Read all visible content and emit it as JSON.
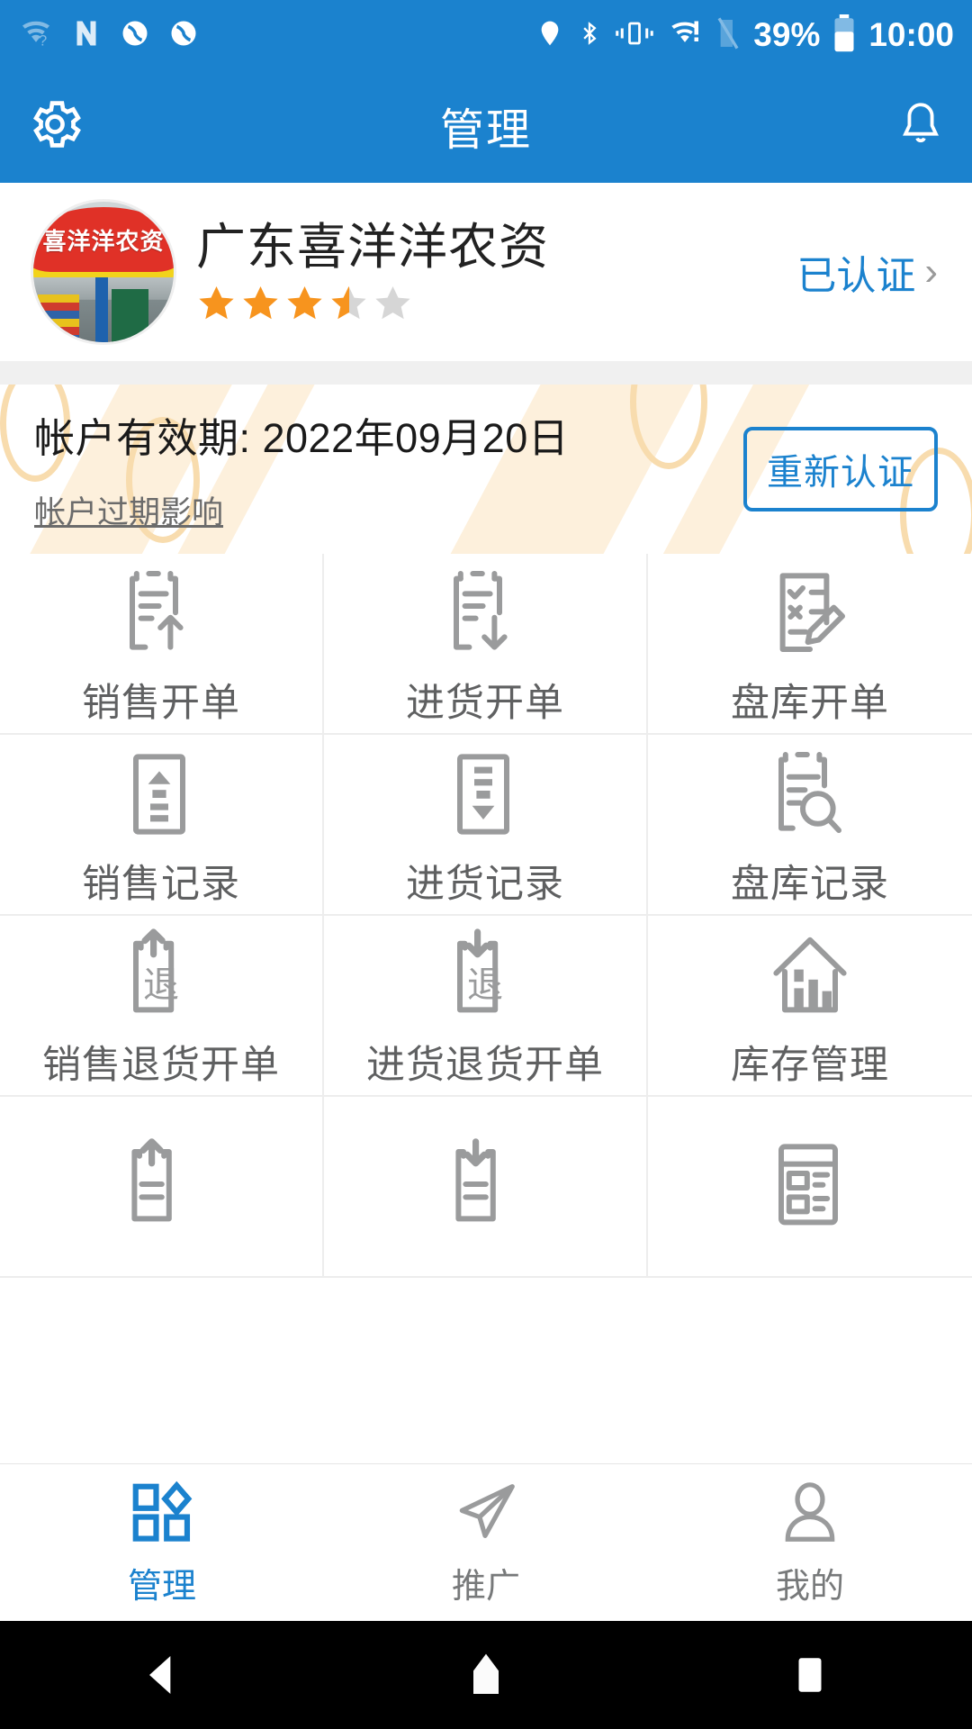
{
  "status_bar": {
    "left_icons": [
      "wifi-question-icon",
      "nfc-n-icon",
      "sync-icon",
      "sync-icon"
    ],
    "right_icons": [
      "location-icon",
      "bluetooth-icon",
      "vibrate-icon",
      "wifi-alert-icon",
      "signal-off-icon"
    ],
    "battery_percent": "39%",
    "time": "10:00"
  },
  "app_bar": {
    "title": "管理",
    "left_icon": "gear-icon",
    "right_icon": "bell-icon"
  },
  "profile": {
    "avatar_sign_text": "喜洋洋农资",
    "shop_name": "广东喜洋洋农资",
    "rating": 3.5,
    "rating_max": 5,
    "verified_label": "已认证",
    "chevron": "›"
  },
  "account": {
    "expiry_label": "帐户有效期: 2022年09月20日",
    "impact_link": "帐户过期影响",
    "recertify_button": "重新认证"
  },
  "grid": {
    "items": [
      {
        "label": "销售开单",
        "icon": "doc-arrow-up-icon"
      },
      {
        "label": "进货开单",
        "icon": "doc-arrow-down-icon"
      },
      {
        "label": "盘库开单",
        "icon": "checklist-pencil-icon"
      },
      {
        "label": "销售记录",
        "icon": "box-triangle-up-icon"
      },
      {
        "label": "进货记录",
        "icon": "box-triangle-down-icon"
      },
      {
        "label": "盘库记录",
        "icon": "doc-search-icon"
      },
      {
        "label": "销售退货开单",
        "icon": "return-up-icon",
        "icon_text": "退"
      },
      {
        "label": "进货退货开单",
        "icon": "return-down-icon",
        "icon_text": "退"
      },
      {
        "label": "库存管理",
        "icon": "warehouse-icon"
      },
      {
        "label": "",
        "icon": "doc-lines-up-icon"
      },
      {
        "label": "",
        "icon": "doc-lines-down-icon"
      },
      {
        "label": "",
        "icon": "ledger-icon"
      }
    ]
  },
  "tab_bar": {
    "tabs": [
      {
        "label": "管理",
        "icon": "grid-diamond-icon",
        "active": true
      },
      {
        "label": "推广",
        "icon": "paper-plane-icon",
        "active": false
      },
      {
        "label": "我的",
        "icon": "person-icon",
        "active": false
      }
    ]
  },
  "nav_bar": {
    "back": "back-triangle-icon",
    "home": "home-pentagon-icon",
    "recents": "recents-square-icon"
  },
  "colors": {
    "brand_blue": "#1B82CE",
    "star_orange": "#F7941E",
    "icon_gray": "#9a9b9c",
    "label_gray": "#5f6061",
    "band_gray": "#f0f0f0",
    "banner_cream": "#FDF0DC"
  }
}
